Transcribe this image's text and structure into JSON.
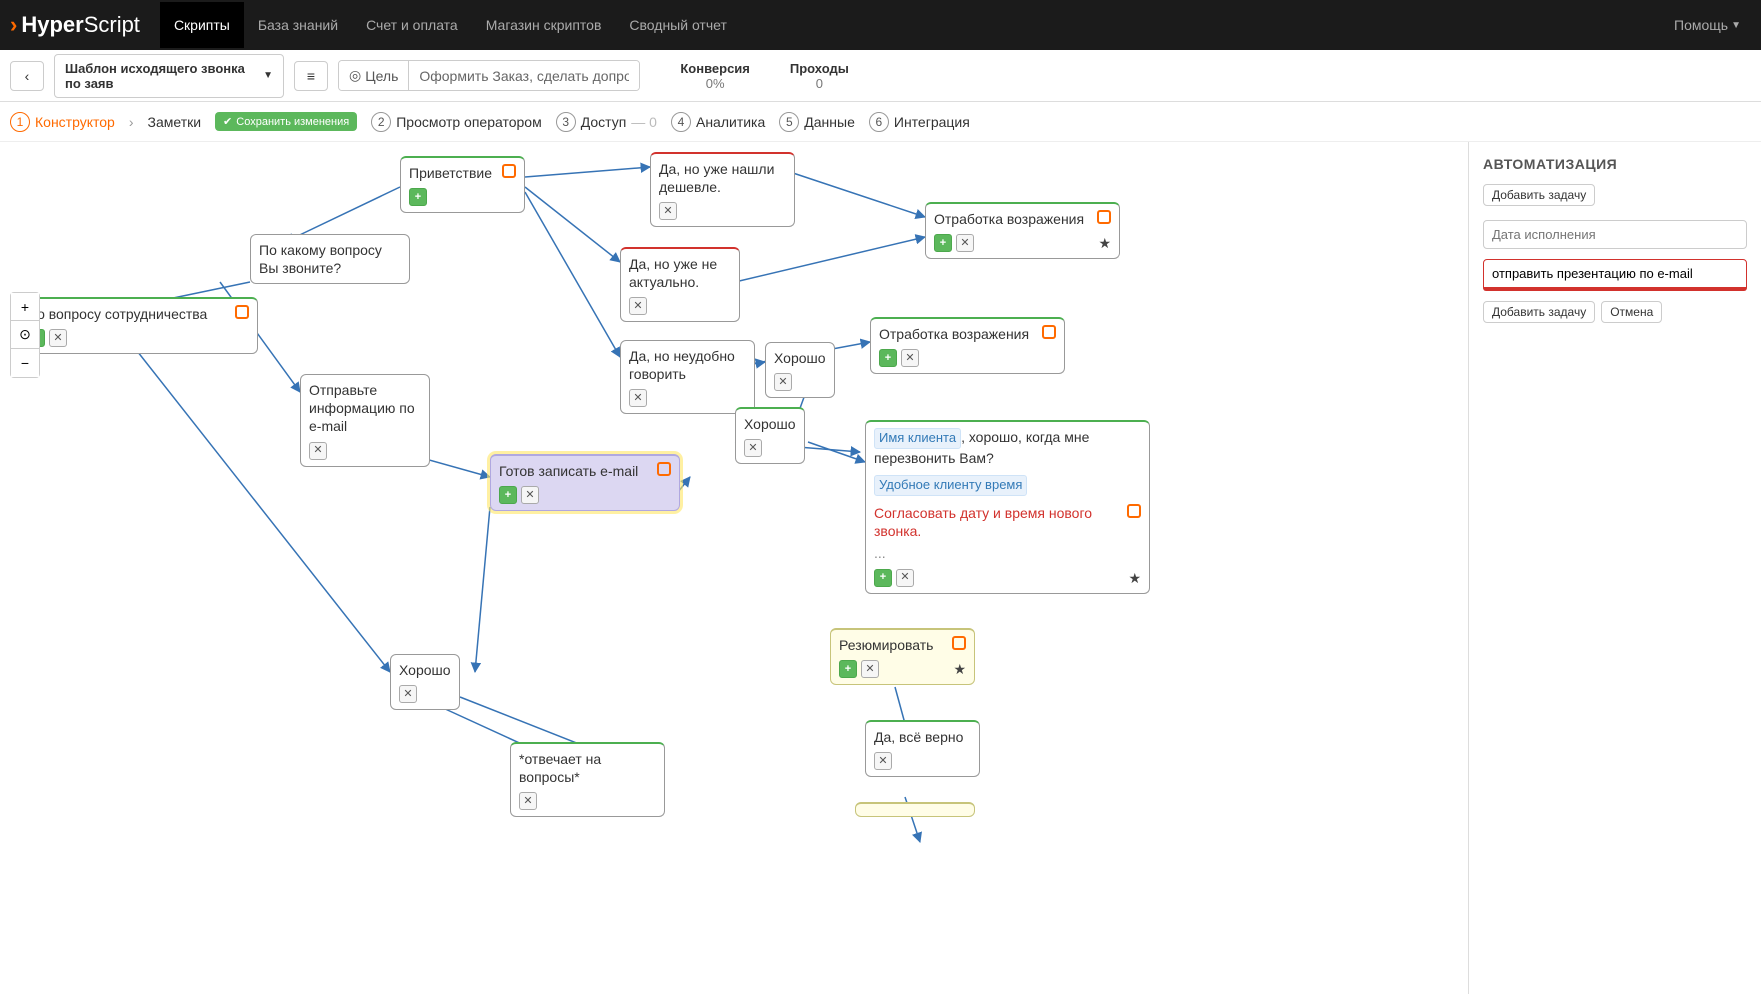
{
  "nav": {
    "logo_bold": "Hyper",
    "logo_light": "Script",
    "items": [
      "Скрипты",
      "База знаний",
      "Счет и оплата",
      "Магазин скриптов",
      "Сводный отчет"
    ],
    "active": 0,
    "help": "Помощь"
  },
  "toolbar": {
    "template_name": "Шаблон исходящего звонка по заяв",
    "goal_label": "Цель",
    "goal_value": "Оформить Заказ, сделать допродажу",
    "stats": {
      "conversion_label": "Конверсия",
      "conversion_value": "0%",
      "passes_label": "Проходы",
      "passes_value": "0"
    }
  },
  "tabs": {
    "constructor": "Конструктор",
    "notes": "Заметки",
    "save": "Сохранить изменения",
    "items": [
      {
        "n": "2",
        "label": "Просмотр оператором"
      },
      {
        "n": "3",
        "label": "Доступ",
        "suffix": "— 0"
      },
      {
        "n": "4",
        "label": "Аналитика"
      },
      {
        "n": "5",
        "label": "Данные"
      },
      {
        "n": "6",
        "label": "Интеграция"
      }
    ]
  },
  "nodes": {
    "welcome": "Приветствие",
    "question": "По какому вопросу Вы звоните?",
    "coop": "По вопросу сотрудничества",
    "send_email": "Отправьте информацию по e-mail",
    "cheaper": "Да, но уже нашли дешевле.",
    "not_actual": "Да, но уже не актуально.",
    "inconvenient": "Да, но неудобно говорить",
    "ok1": "Хорошо",
    "ok2": "Хорошо",
    "ok3": "Хорошо",
    "objection1": "Отработка возражения",
    "objection2": "Отработка возражения",
    "ready_email": "Готов записать e-mail",
    "summarize": "Резюмировать",
    "yes_correct": "Да, всё верно",
    "answers": "*отвечает на вопросы*",
    "big": {
      "chip1": "Имя клиента",
      "text1": ", хорошо, когда мне перезвонить Вам?",
      "chip2": "Удобное клиенту время",
      "red": "Согласовать дату и время нового звонка.",
      "dots": "..."
    }
  },
  "panel": {
    "title": "АВТОМАТИЗАЦИЯ",
    "add_task": "Добавить задачу",
    "date_placeholder": "Дата исполнения",
    "task_value": "отправить презентацию по e-mail",
    "add_task2": "Добавить задачу",
    "cancel": "Отмена"
  }
}
